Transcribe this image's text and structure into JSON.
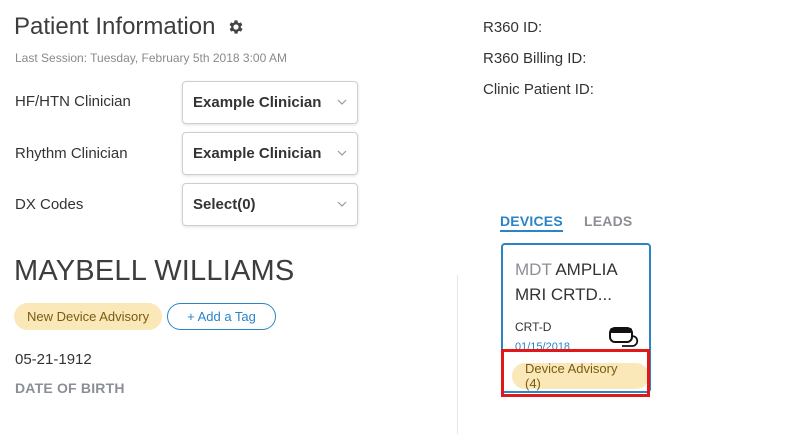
{
  "header": {
    "title": "Patient Information",
    "settings_icon": "gear-icon",
    "last_session": "Last Session: Tuesday, February 5th 2018 3:00 AM"
  },
  "fields": {
    "hf_htn": {
      "label": "HF/HTN Clinician",
      "value": "Example Clinician"
    },
    "rhythm": {
      "label": "Rhythm Clinician",
      "value": "Example Clinician"
    },
    "dx_codes": {
      "label": "DX Codes",
      "value": "Select(0)"
    }
  },
  "patient": {
    "name": "MAYBELL WILLIAMS",
    "tags": [
      "New Device Advisory"
    ],
    "add_tag_label": "+ Add a Tag",
    "dob": "05-21-1912",
    "dob_label": "DATE OF BIRTH"
  },
  "ids": {
    "r360_id_label": "R360 ID:",
    "r360_billing_label": "R360 Billing ID:",
    "clinic_patient_label": "Clinic Patient ID:"
  },
  "tabs": [
    {
      "label": "DEVICES",
      "active": true
    },
    {
      "label": "LEADS",
      "active": false
    }
  ],
  "device": {
    "manufacturer": "MDT",
    "model": "AMPLIA MRI CRTD...",
    "type": "CRT-D",
    "date": "01/15/2018",
    "advisory": "Device Advisory (4)",
    "icon": "device-icon"
  },
  "colors": {
    "accent": "#2b84c6",
    "advisory_bg": "#fbe8b9",
    "advisory_text": "#7a5b12",
    "highlight": "#e01818"
  }
}
